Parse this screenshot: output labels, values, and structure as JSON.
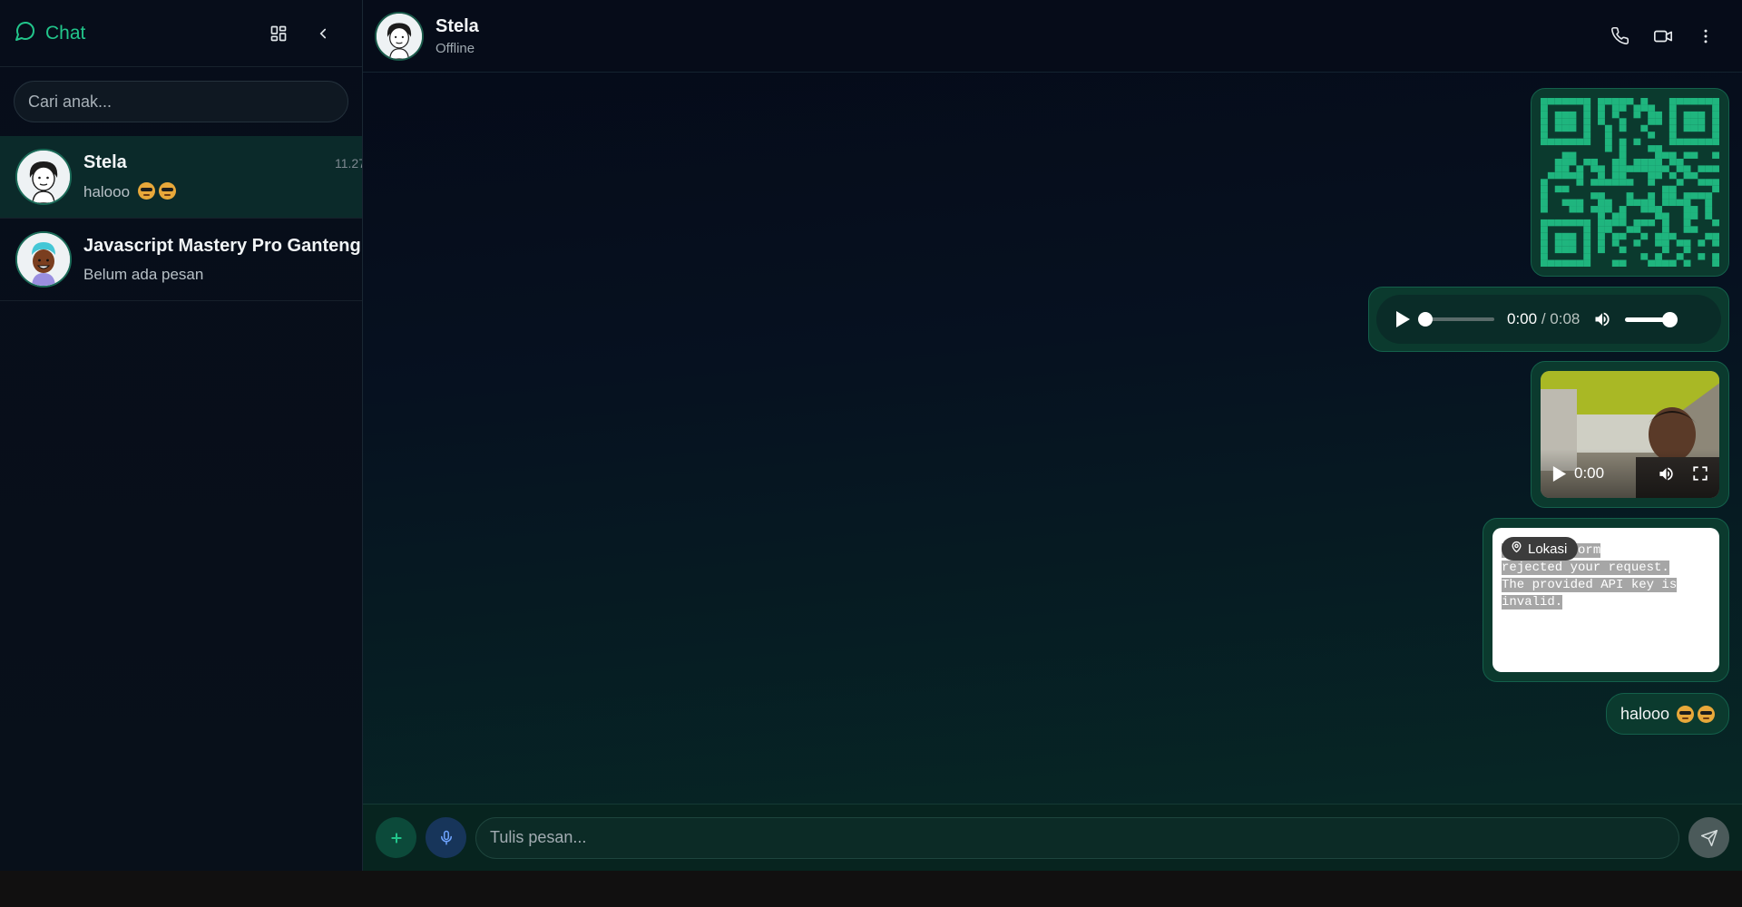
{
  "sidebar": {
    "title": "Chat",
    "search_placeholder": "Cari anak...",
    "contacts": [
      {
        "name": "Stela",
        "preview": "halooo",
        "time": "11.27",
        "active": true
      },
      {
        "name": "Javascript Mastery Pro Ganteng",
        "preview": "Belum ada pesan",
        "time": "",
        "active": false
      }
    ]
  },
  "chat": {
    "name": "Stela",
    "status": "Offline",
    "audio": {
      "current": "0:00",
      "separator": "/",
      "duration": "0:08",
      "progress": 0.0,
      "volume": 1.0
    },
    "video": {
      "current": "0:00"
    },
    "map": {
      "badge": "Lokasi",
      "error_lines": [
        "Maps Platform",
        "rejected your request.",
        "The provided API key is",
        "invalid."
      ]
    },
    "text_message": "halooo"
  },
  "composer": {
    "placeholder": "Tulis pesan..."
  },
  "colors": {
    "accent": "#22c58b",
    "bubble": "#0b3a2e",
    "qr": "#1fb57e"
  }
}
